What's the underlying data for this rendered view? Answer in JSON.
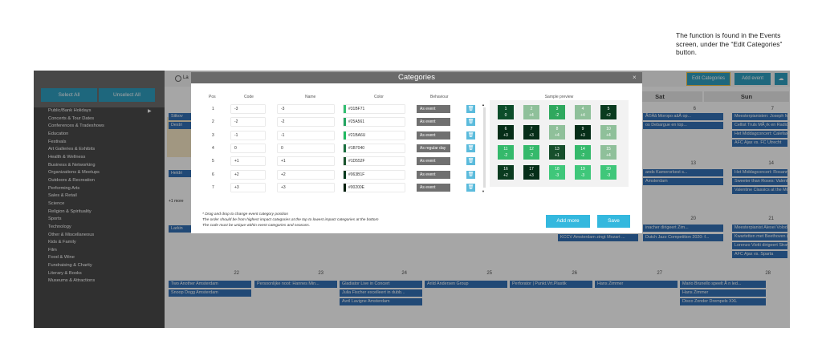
{
  "annotation": "The function is found in the Events screen, under the “Edit Categories” button.",
  "sidebar": {
    "select_all": "Select All",
    "unselect_all": "Unselect All",
    "categories": [
      "Public/Bank Holidays",
      "Concerts & Tour Dates",
      "Conferences & Tradeshows",
      "Education",
      "Festivals",
      "Art Galleries & Exhibits",
      "Health & Wellness",
      "Business & Networking",
      "Organizations & Meetups",
      "Outdoors & Recreation",
      "Performing Arts",
      "Sales & Retail",
      "Science",
      "Religion & Spirituality",
      "Sports",
      "Technology",
      "Other & Miscellaneous",
      "Kids & Family",
      "Film",
      "Food & Wine",
      "Fundraising & Charity",
      "Literary & Books",
      "Museums & Attractions"
    ]
  },
  "toolbar": {
    "radio_label": "La",
    "edit_categories": "Edit Categories",
    "add_event": "Add event",
    "cloud_icon": "☁"
  },
  "calendar": {
    "days": [
      "Sat",
      "Sun"
    ],
    "numbers": [
      "6",
      "7",
      "13",
      "14",
      "20",
      "21",
      "22",
      "23",
      "24",
      "25",
      "26",
      "27",
      "28"
    ],
    "events": {
      "r1_left": [
        "Sitkov",
        "Destri"
      ],
      "r1_sat": [
        "Ã©Ââ Moropo aâÂ op...",
        "os Debargue en top..."
      ],
      "r1_sun": [
        "Meesterpianisten: Joseph Moog",
        "Cellist Truls MÃ¸rk en Radio Fil...",
        "Het Middagconcert: Calefax sp...",
        "AFC Ajax vs. FC Utrecht"
      ],
      "r2_left": [
        "Heldri"
      ],
      "r2_sat": [
        "ands Kamerorkest s...",
        "Amsterdam"
      ],
      "r2_sun": [
        "Het Middagconcert: Rosanne P...",
        "Sweeter than Roses: Valentijns...",
        "Valentine Classics at the Movie..."
      ],
      "more": "+1 more",
      "r3_left": [
        "Larkin"
      ],
      "r3_fri": [
        "KCCV Amsterdam zingt Mozart ..."
      ],
      "r3_sat": [
        "Dutch Jazz Competition 2020: f..."
      ],
      "r3_sat_top": [
        "inacher dirigeert Zim..."
      ],
      "r3_sun": [
        "Meesterpianist Alexei Volodin i...",
        "Kwartetten met Beethoven (6+)",
        "Lorenzo Viotti dirigeert Stravin...",
        "AFC Ajax vs. Sparta"
      ],
      "r4_mon": [
        "Two Another Amsterdam",
        "Snoop Dogg Amsterdam"
      ],
      "r4_tue": [
        "Persoonlijke noot: Hannes Min..."
      ],
      "r4_wed": [
        "Gladiator Live in Concert",
        "Julia Fischer excelleert in dubb...",
        "Avril Lavigne Amsterdam"
      ],
      "r4_thu": [
        "Arild Andersen Group"
      ],
      "r4_fri": [
        "Perforator | Punkt.Vrt.Plastik"
      ],
      "r4_sat": [
        "Hans Zimmer"
      ],
      "r4_sun": [
        "Mario Brunello speelt Ã  n led...",
        "Hans Zimmer",
        "Disco Zonder Drempels XXL"
      ]
    }
  },
  "modal": {
    "title": "Categories",
    "close": "×",
    "headers": {
      "pos": "Pos",
      "code": "Code",
      "name": "Name",
      "color": "Color",
      "behaviour": "Behaviour",
      "sample": "Sample preview"
    },
    "rows": [
      {
        "pos": "1",
        "code": "-3",
        "name": "-3",
        "color": "#31BF71",
        "hex": "#31bf71",
        "behaviour": "As event"
      },
      {
        "pos": "2",
        "code": "-2",
        "name": "-2",
        "color": "#25A561",
        "hex": "#25a561",
        "behaviour": "As event"
      },
      {
        "pos": "3",
        "code": "-1",
        "name": "-1",
        "color": "#21BA6U",
        "hex": "#21ba60",
        "behaviour": "As event"
      },
      {
        "pos": "4",
        "code": "0",
        "name": "0",
        "color": "#1B7040",
        "hex": "#1b7040",
        "behaviour": "As regular day"
      },
      {
        "pos": "5",
        "code": "+1",
        "name": "+1",
        "color": "#1D552F",
        "hex": "#1d552f",
        "behaviour": "As event"
      },
      {
        "pos": "6",
        "code": "+2",
        "name": "+2",
        "color": "#063B1F",
        "hex": "#063b1f",
        "behaviour": "As event"
      },
      {
        "pos": "7",
        "code": "+3",
        "name": "+3",
        "color": "#00200E",
        "hex": "#00200e",
        "behaviour": "As event"
      }
    ],
    "delete_icon": "🗑",
    "preview": [
      {
        "n": "1",
        "c": "0",
        "bg": "#0c4d2a"
      },
      {
        "n": "2",
        "c": "+4",
        "bg": "#8fc09a"
      },
      {
        "n": "3",
        "c": "-2",
        "bg": "#2fa85e"
      },
      {
        "n": "4",
        "c": "+4",
        "bg": "#8fc09a"
      },
      {
        "n": "5",
        "c": "+2",
        "bg": "#0a3b1f"
      },
      {
        "n": "6",
        "c": "+3",
        "bg": "#062e18"
      },
      {
        "n": "7",
        "c": "+3",
        "bg": "#062e18"
      },
      {
        "n": "8",
        "c": "+4",
        "bg": "#8fc09a"
      },
      {
        "n": "9",
        "c": "+3",
        "bg": "#062e18"
      },
      {
        "n": "10",
        "c": "+4",
        "bg": "#8fc09a"
      },
      {
        "n": "11",
        "c": "-2",
        "bg": "#35b96b"
      },
      {
        "n": "12",
        "c": "-2",
        "bg": "#35b96b"
      },
      {
        "n": "13",
        "c": "+1",
        "bg": "#174f2c"
      },
      {
        "n": "14",
        "c": "-2",
        "bg": "#35b96b"
      },
      {
        "n": "15",
        "c": "+4",
        "bg": "#8fc09a"
      },
      {
        "n": "16",
        "c": "+2",
        "bg": "#0a3b1f"
      },
      {
        "n": "17",
        "c": "+3",
        "bg": "#062e18"
      },
      {
        "n": "18",
        "c": "-3",
        "bg": "#3fc77a"
      },
      {
        "n": "19",
        "c": "-3",
        "bg": "#3fc77a"
      },
      {
        "n": "20",
        "c": "-3",
        "bg": "#3fc77a"
      }
    ],
    "footnotes": [
      "* Drag and drop to change event category position",
      "The order should be from highest impact categories at the top to lowest impact categories at the bottom",
      "The code must be unique within event categories and seasons."
    ],
    "add_more": "Add more",
    "save": "Save"
  }
}
